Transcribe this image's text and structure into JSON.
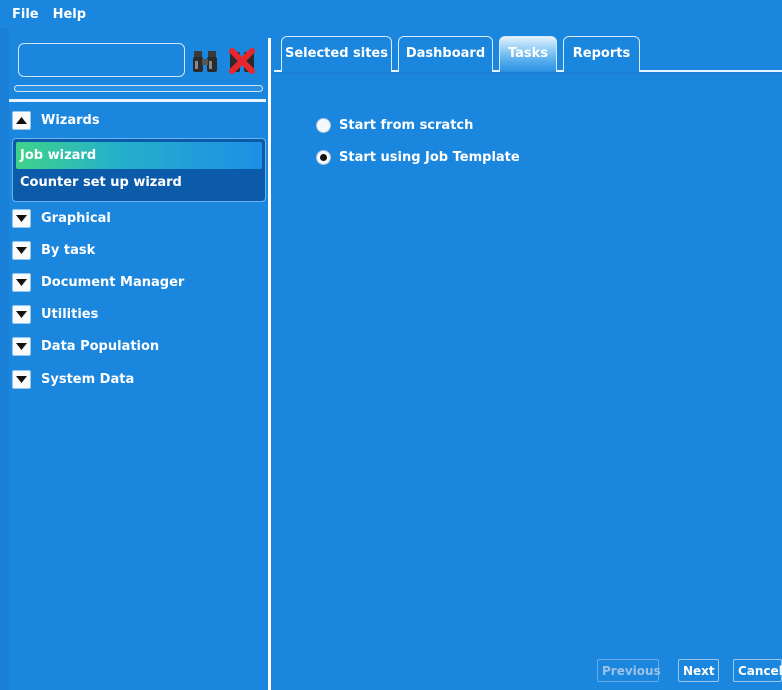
{
  "menu": {
    "file": "File",
    "help": "Help"
  },
  "search": {
    "value": ""
  },
  "sections": {
    "wizards": "Wizards",
    "graphical": "Graphical",
    "by_task": "By task",
    "document_manager": "Document Manager",
    "utilities": "Utilities",
    "data_population": "Data Population",
    "system_data": "System Data"
  },
  "wizards": {
    "items": [
      "Job wizard",
      "Counter set up wizard"
    ],
    "selected": "Job wizard"
  },
  "tabs": [
    "Selected sites",
    "Dashboard",
    "Tasks",
    "Reports"
  ],
  "active_tab": "Tasks",
  "options": {
    "scratch": "Start from scratch",
    "template": "Start using Job Template",
    "selected": "Start using Job Template"
  },
  "buttons": {
    "previous": "Previous",
    "next": "Next",
    "cancel": "Cancel"
  },
  "colors": {
    "background": "#1a86de",
    "selection_start": "#3fd38a",
    "list_bg": "#0c5bab"
  },
  "icons": {
    "find": "binoculars-icon",
    "clear": "clear-search-icon",
    "expand": "chevron-down-icon",
    "collapse": "chevron-up-icon"
  }
}
